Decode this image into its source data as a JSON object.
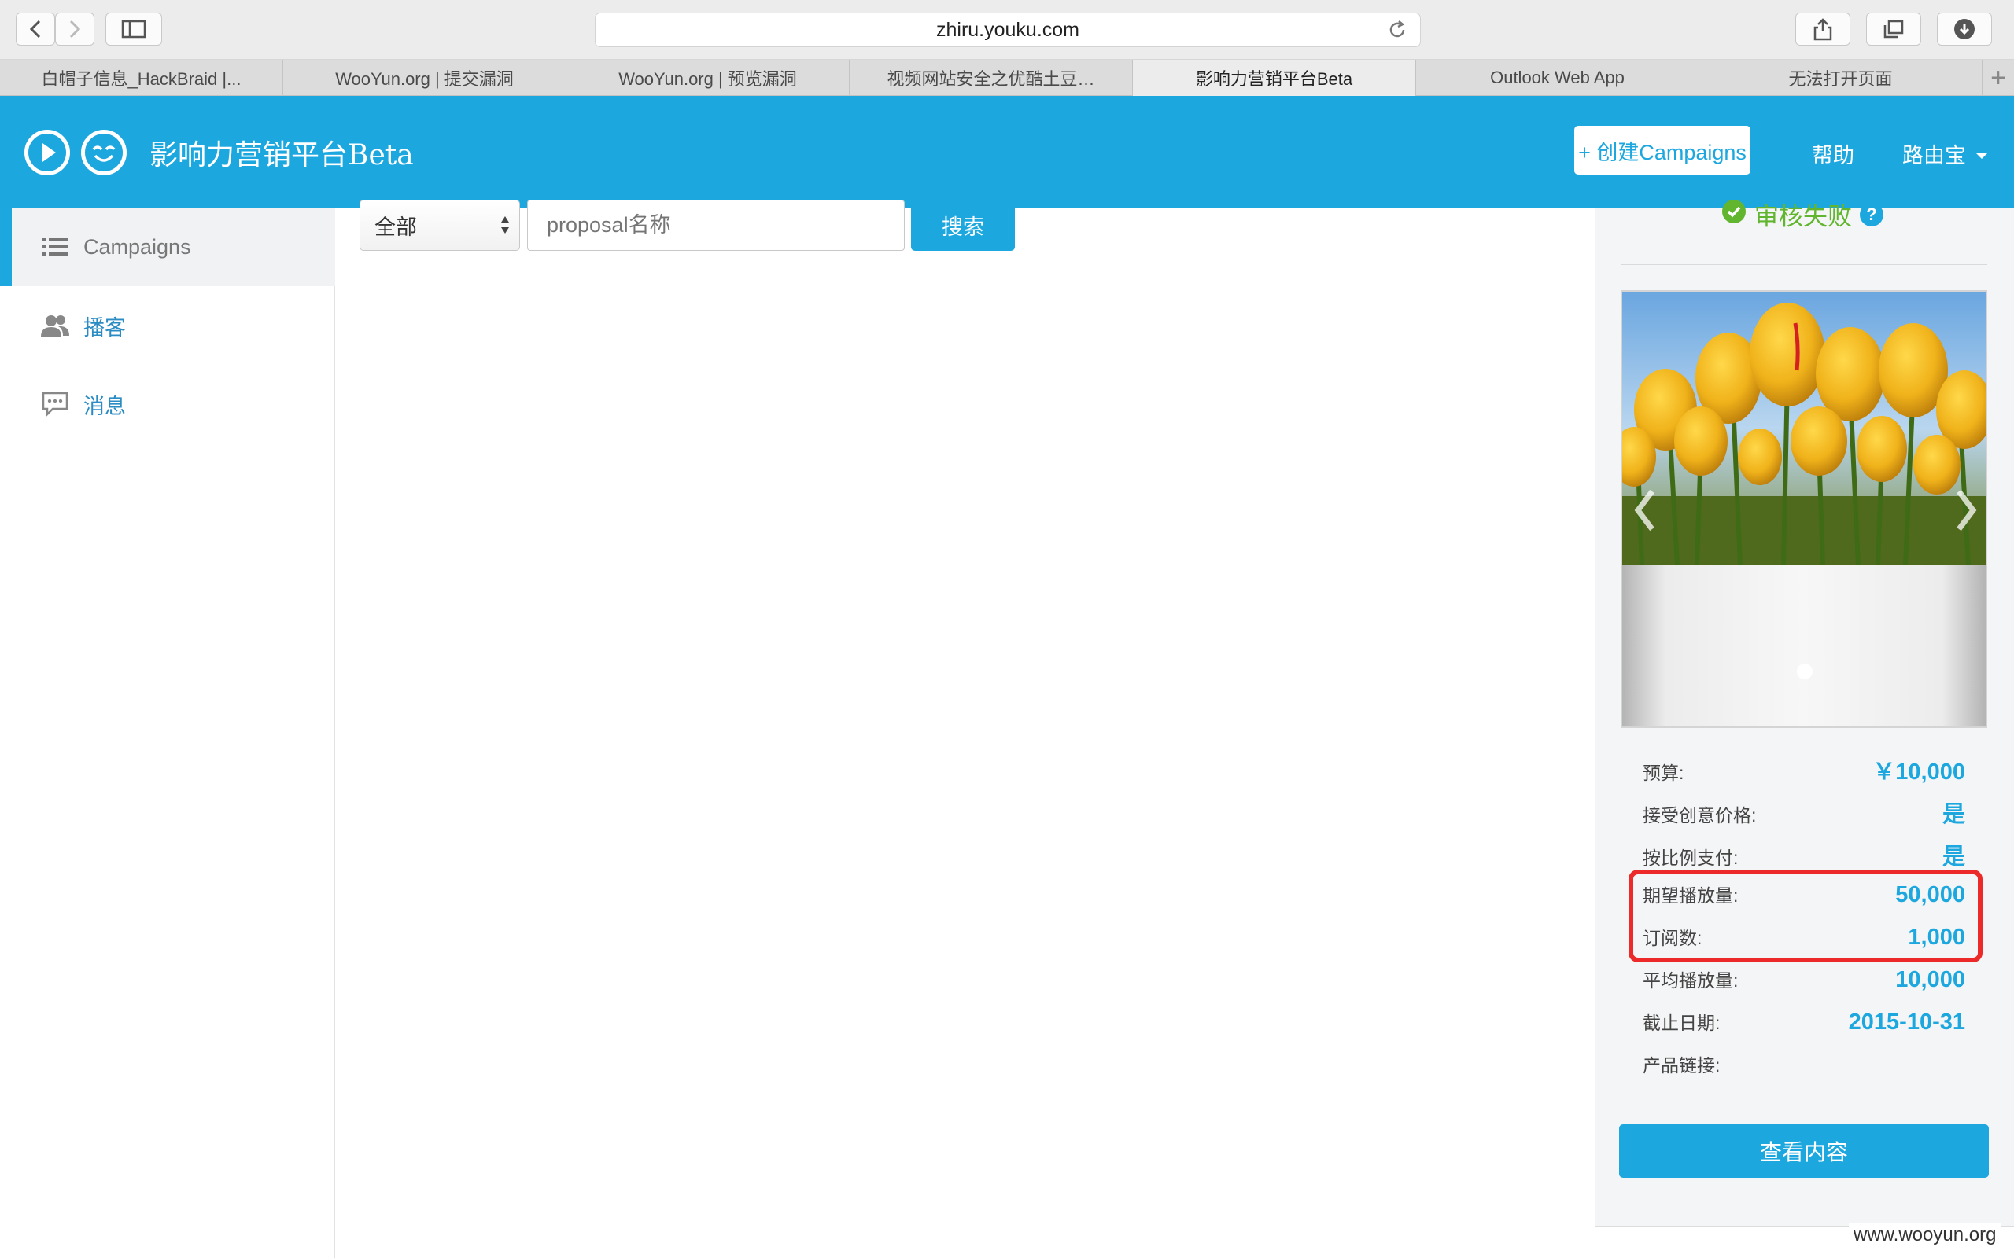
{
  "browser": {
    "url": "zhiru.youku.com",
    "tabs": [
      "白帽子信息_HackBraid |...",
      "WooYun.org | 提交漏洞",
      "WooYun.org | 预览漏洞",
      "视频网站安全之优酷土豆…",
      "影响力营销平台Beta",
      "Outlook Web App",
      "无法打开页面"
    ],
    "add_tab": "+"
  },
  "header": {
    "brand": "影响力营销平台Beta",
    "create_button": "+ 创建Campaigns",
    "help": "帮助",
    "user": "路由宝"
  },
  "sidebar": {
    "items": [
      {
        "label": "Campaigns",
        "icon": "list-icon",
        "active": true
      },
      {
        "label": "播客",
        "icon": "users-icon",
        "active": false
      },
      {
        "label": "消息",
        "icon": "message-icon",
        "active": false
      }
    ]
  },
  "search": {
    "filter_value": "全部",
    "input_placeholder": "proposal名称",
    "button": "搜索"
  },
  "panel": {
    "status": "审核失败",
    "status_help": "?",
    "details": [
      {
        "label": "预算:",
        "value": "￥10,000"
      },
      {
        "label": "接受创意价格:",
        "value": "是"
      },
      {
        "label": "按比例支付:",
        "value": "是"
      },
      {
        "label": "期望播放量:",
        "value": "50,000"
      },
      {
        "label": "订阅数:",
        "value": "1,000"
      },
      {
        "label": "平均播放量:",
        "value": "10,000"
      },
      {
        "label": "截止日期:",
        "value": "2015-10-31"
      },
      {
        "label": "产品链接:",
        "value": ""
      }
    ],
    "view_button": "查看内容"
  },
  "watermark": "www.wooyun.org",
  "colors": {
    "brand_blue": "#1da7df",
    "status_green": "#62b52f",
    "highlight_red": "#ec2a2a"
  }
}
